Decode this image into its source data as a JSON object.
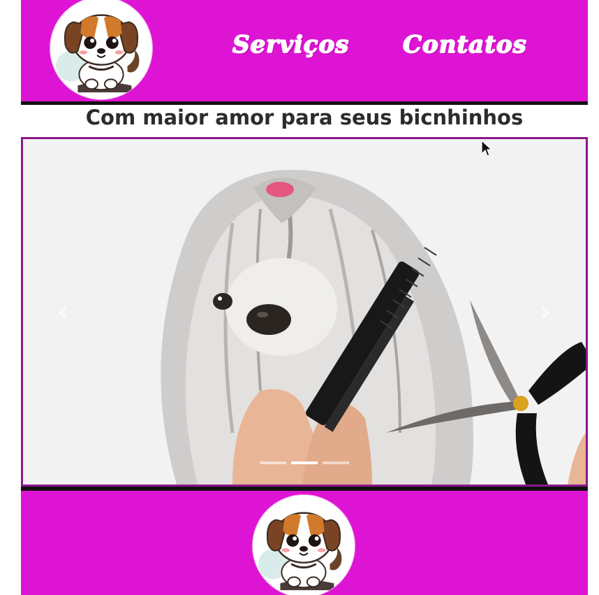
{
  "header": {
    "logo_icon": "puppy-logo-icon",
    "nav": {
      "servicos": "Serviços",
      "contatos": "Contatos"
    }
  },
  "main": {
    "tagline": "Com maior amor para seus bicnhinhos"
  },
  "carousel": {
    "prev_icon": "chevron-left-icon",
    "next_icon": "chevron-right-icon",
    "prev_glyph": "‹",
    "next_glyph": "›",
    "slide_count": 3,
    "active_index": 1
  },
  "footer": {
    "logo_icon": "puppy-logo-icon"
  },
  "colors": {
    "brand_magenta": "#de14d4",
    "carousel_border": "#8b178a",
    "rule": "#111111",
    "text": "#2c2c2c"
  }
}
